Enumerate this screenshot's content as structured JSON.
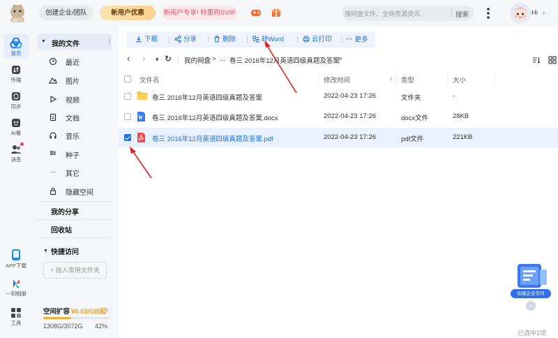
{
  "header": {
    "enterprise_btn": "创建企业/团队",
    "newuser_btn": "新用户优惠",
    "svip_btn": "新用户专享! 特惠购SVIP",
    "search_placeholder": "搜网盘文件、全网资源资讯",
    "search_btn": "搜索",
    "greeting": "Hi",
    "chevron": "›"
  },
  "rail": {
    "items": [
      {
        "label": "首页",
        "icon": "home-icon"
      },
      {
        "label": "传输",
        "icon": "transfer-icon"
      },
      {
        "label": "同步",
        "icon": "sync-icon"
      },
      {
        "label": "AI看",
        "icon": "ai-icon"
      },
      {
        "label": "消息",
        "icon": "message-icon"
      },
      {
        "label": "APP下载",
        "icon": "app-download-icon"
      },
      {
        "label": "一刻相册",
        "icon": "album-icon"
      },
      {
        "label": "工具",
        "icon": "tools-icon"
      }
    ]
  },
  "nav": {
    "my_files": "我的文件",
    "kebab": "⋮",
    "items": [
      {
        "label": "最近",
        "icon": "clock-icon"
      },
      {
        "label": "图片",
        "icon": "image-icon"
      },
      {
        "label": "视频",
        "icon": "video-icon"
      },
      {
        "label": "文档",
        "icon": "document-icon"
      },
      {
        "label": "音乐",
        "icon": "music-icon"
      },
      {
        "label": "种子",
        "icon": "torrent-icon",
        "glyph": "Bt"
      },
      {
        "label": "其它",
        "icon": "more-icon",
        "glyph": "···"
      },
      {
        "label": "隐藏空间",
        "icon": "lock-icon"
      }
    ],
    "my_share": "我的分享",
    "recycle": "回收站",
    "quick_access": "快捷访问",
    "add_fav": "+ 拖入常用文件夹",
    "expand_title": "空间扩容",
    "expand_price": "¥0.03/GB起",
    "expand_chev": "›",
    "usage": "1308G/3072G",
    "usage_pct": "42%",
    "usage_fraction": 0.42
  },
  "toolbar": {
    "download": "下载",
    "share": "分享",
    "delete": "删除",
    "to_word": "转Word",
    "cloud_print": "云打印",
    "more": "更多"
  },
  "breadcrumb": {
    "back": "‹",
    "forward": "›",
    "dropdown": "▾",
    "refresh": "↻",
    "root": "我的网盘",
    "sep1": ">",
    "ellipsis": "...",
    "current": "卷三 2016年12月英语四级真题及答案",
    "sep2": ">"
  },
  "table": {
    "headers": {
      "name": "文件名",
      "modified": "修改时间",
      "sort_arrow": "↓",
      "type": "类型",
      "size": "大小"
    },
    "rows": [
      {
        "name": "卷三 2016年12月英语四级真题及答案",
        "modified": "2022-04-23 17:26",
        "type": "文件夹",
        "size": "-",
        "kind": "folder",
        "checked": false
      },
      {
        "name": "卷三 2016年12月英语四级真题及答案.docx",
        "modified": "2022-04-23 17:26",
        "type": "docx文件",
        "size": "28KB",
        "kind": "docx",
        "checked": false
      },
      {
        "name": "卷三 2016年12月英语四级真题及答案.pdf",
        "modified": "2022-04-23 17:26",
        "type": "pdf文件",
        "size": "221KB",
        "kind": "pdf",
        "checked": true
      }
    ]
  },
  "status": "已选中1项",
  "float_widget": {
    "label": "创建企业空间",
    "close": "×"
  },
  "colors": {
    "accent": "#1a73e8",
    "annotation": "#e02020",
    "svip": "#ef4f6c",
    "price": "#f0a020"
  }
}
